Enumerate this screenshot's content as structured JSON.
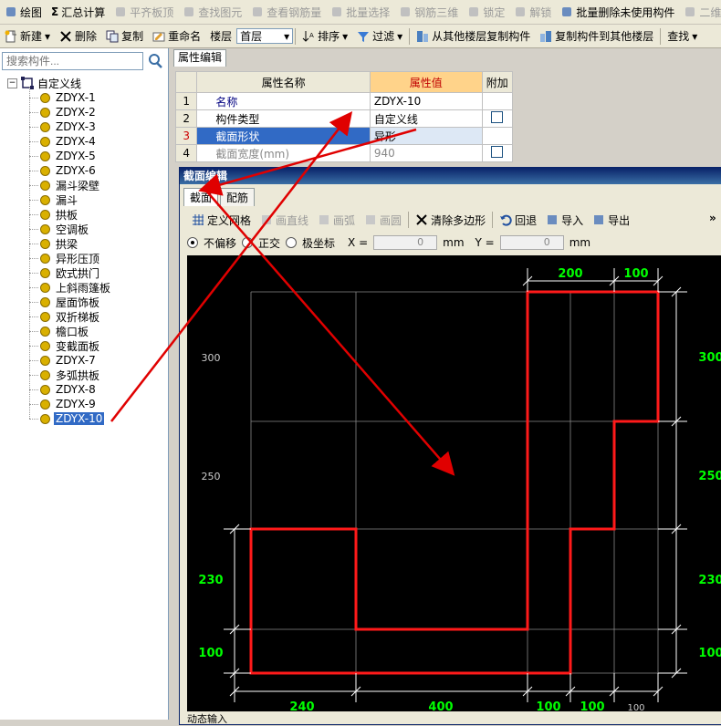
{
  "toolbar1": {
    "items": [
      {
        "label": "绘图",
        "enabled": true
      },
      {
        "label": "汇总计算",
        "prefix": "Σ",
        "enabled": true
      },
      {
        "label": "平齐板顶",
        "enabled": false
      },
      {
        "label": "查找图元",
        "enabled": false
      },
      {
        "label": "查看钢筋量",
        "enabled": false
      },
      {
        "label": "批量选择",
        "enabled": false
      },
      {
        "label": "钢筋三维",
        "enabled": false
      },
      {
        "label": "锁定",
        "enabled": false
      },
      {
        "label": "解锁",
        "enabled": false
      },
      {
        "label": "批量删除未使用构件",
        "enabled": true
      },
      {
        "label": "二维",
        "enabled": false
      }
    ]
  },
  "toolbar2": {
    "new_label": "新建",
    "delete_label": "删除",
    "copy_label": "复制",
    "rename_label": "重命名",
    "floor_label": "楼层",
    "floor_value": "首层",
    "sort_label": "排序",
    "filter_label": "过滤",
    "copy_from_label": "从其他楼层复制构件",
    "copy_to_label": "复制构件到其他楼层",
    "find_label": "查找"
  },
  "left": {
    "search_placeholder": "搜索构件...",
    "root": "自定义线",
    "items": [
      "ZDYX-1",
      "ZDYX-2",
      "ZDYX-3",
      "ZDYX-4",
      "ZDYX-5",
      "ZDYX-6",
      "漏斗梁壁",
      "漏斗",
      "拱板",
      "空调板",
      "拱梁",
      "异形压顶",
      "欧式拱门",
      "上斜雨篷板",
      "屋面饰板",
      "双折梯板",
      "檐口板",
      "变截面板",
      "ZDYX-7",
      "多弧拱板",
      "ZDYX-8",
      "ZDYX-9",
      "ZDYX-10"
    ],
    "selected_index": 22
  },
  "props": {
    "tab": "属性编辑",
    "col_name": "属性名称",
    "col_value": "属性值",
    "col_extra": "附加",
    "rows": [
      {
        "num": "1",
        "name": "名称",
        "value": "ZDYX-10"
      },
      {
        "num": "2",
        "name": "构件类型",
        "value": "自定义线"
      },
      {
        "num": "3",
        "name": "截面形状",
        "value": "异形"
      },
      {
        "num": "4",
        "name": "截面宽度(mm)",
        "value": "940"
      }
    ]
  },
  "dialog": {
    "title": "截面编辑",
    "tab_section": "截面",
    "tab_rebar": "配筋",
    "tools": [
      "定义网格",
      "画直线",
      "画弧",
      "画圆",
      "清除多边形",
      "回退",
      "导入",
      "导出"
    ],
    "opt_none": "不偏移",
    "opt_ortho": "正交",
    "opt_polar": "极坐标",
    "x_label": "X =",
    "y_label": "Y =",
    "x_value": "0",
    "y_value": "0",
    "unit": "mm",
    "status": "动态输入"
  },
  "drawing": {
    "dims_top": [
      "200",
      "100"
    ],
    "dims_bottom": [
      "240",
      "400",
      "100",
      "100",
      "100"
    ],
    "dims_right": [
      "300",
      "250",
      "230",
      "100"
    ],
    "dims_left": [
      "300",
      "250",
      "230",
      "100"
    ],
    "colors": {
      "outline": "#ff1a1a",
      "dim": "#00ff00",
      "grid": "#ffffff",
      "bg": "#000000",
      "arrow": "#e00000"
    }
  }
}
